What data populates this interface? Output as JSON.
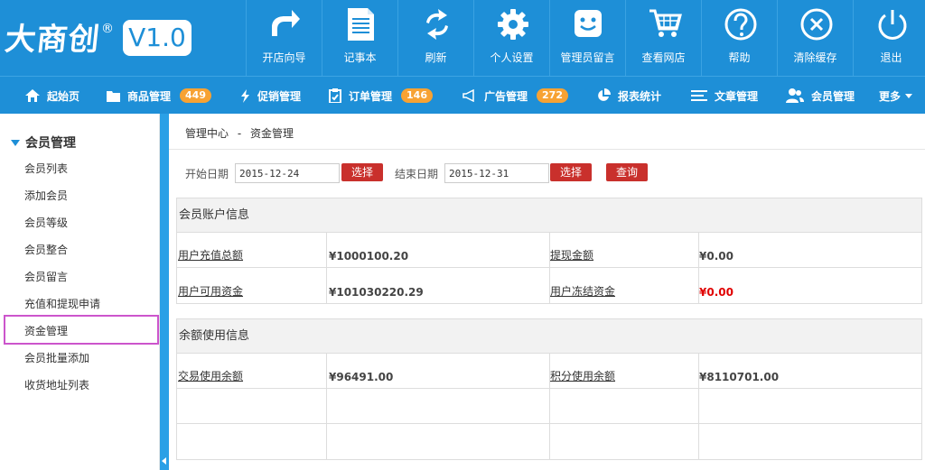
{
  "logo": {
    "text": "大商创",
    "reg": "®",
    "version": "V1.0"
  },
  "tools": [
    {
      "label": "开店向导",
      "icon": "share-arrow-icon"
    },
    {
      "label": "记事本",
      "icon": "notepad-icon"
    },
    {
      "label": "刷新",
      "icon": "refresh-icon"
    },
    {
      "label": "个人设置",
      "icon": "gear-icon"
    },
    {
      "label": "管理员留言",
      "icon": "smiley-message-icon"
    },
    {
      "label": "查看网店",
      "icon": "cart-icon"
    },
    {
      "label": "帮助",
      "icon": "question-icon"
    },
    {
      "label": "清除缓存",
      "icon": "clear-x-icon"
    },
    {
      "label": "退出",
      "icon": "power-icon"
    }
  ],
  "nav": {
    "home": "起始页",
    "goods": "商品管理",
    "goods_count": "449",
    "promo": "促销管理",
    "orders": "订单管理",
    "orders_count": "146",
    "ads": "广告管理",
    "ads_count": "272",
    "reports": "报表统计",
    "articles": "文章管理",
    "members": "会员管理",
    "more": "更多"
  },
  "sidebar": {
    "heading": "会员管理",
    "items": [
      {
        "label": "会员列表"
      },
      {
        "label": "添加会员"
      },
      {
        "label": "会员等级"
      },
      {
        "label": "会员整合"
      },
      {
        "label": "会员留言"
      },
      {
        "label": "充值和提现申请"
      },
      {
        "label": "资金管理"
      },
      {
        "label": "会员批量添加"
      },
      {
        "label": "收货地址列表"
      }
    ]
  },
  "breadcrumb": {
    "root": "管理中心",
    "sep": "-",
    "current": "资金管理"
  },
  "filter": {
    "start_label": "开始日期",
    "start_value": "2015-12-24",
    "end_label": "结束日期",
    "end_value": "2015-12-31",
    "select_label": "选择",
    "query_label": "查询"
  },
  "account": {
    "title": "会员账户信息",
    "rows": [
      {
        "k1": "用户充值总额",
        "v1": "¥1000100.20",
        "k2": "提现金额",
        "v2": "¥0.00"
      },
      {
        "k1": "用户可用资金",
        "v1": "¥101030220.29",
        "k2": "用户冻结资金",
        "v2": "¥0.00"
      }
    ]
  },
  "balance": {
    "title": "余额使用信息",
    "rows": [
      {
        "k1": "交易使用余额",
        "v1": "¥96491.00",
        "k2": "积分使用余额",
        "v2": "¥8110701.00"
      }
    ]
  },
  "colors": {
    "primary": "#1e8fd7",
    "badge": "#f7a233",
    "button": "#c9302c",
    "highlight": "#cc55cc",
    "negative": "#e00000"
  }
}
